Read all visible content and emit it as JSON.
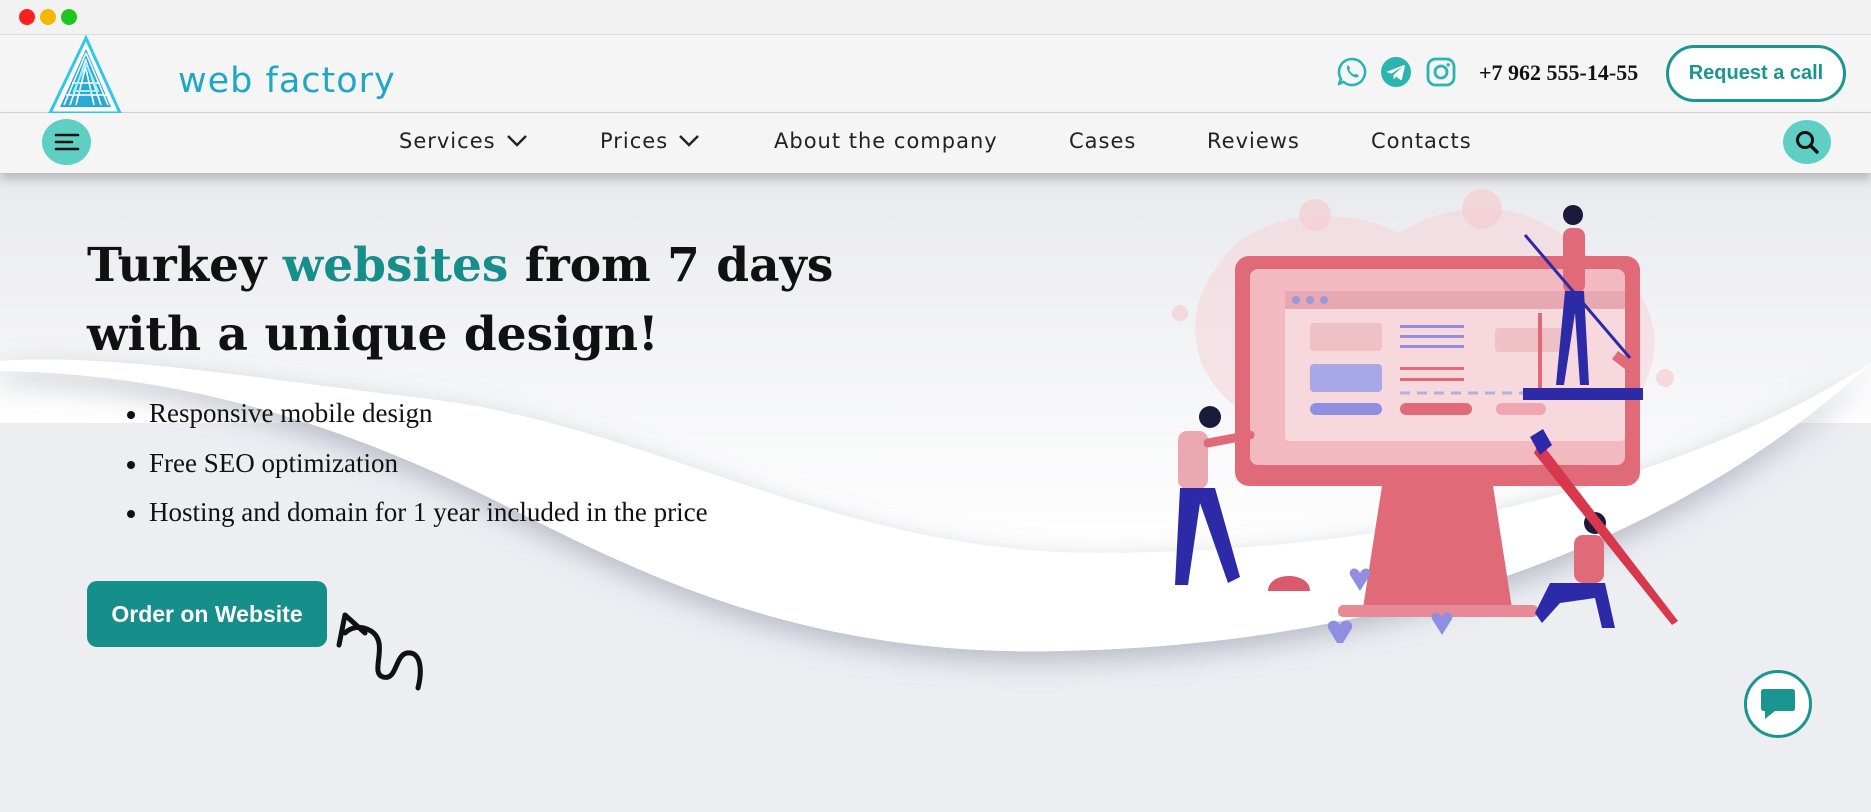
{
  "header": {
    "logo_text": "web factory",
    "phone": "+7 962 555-14-55",
    "request_call_label": "Request a call",
    "social_icons": [
      "whatsapp-icon",
      "telegram-icon",
      "instagram-icon"
    ]
  },
  "nav": {
    "items": [
      {
        "label": "Services",
        "dropdown": true
      },
      {
        "label": "Prices",
        "dropdown": true
      },
      {
        "label": "About the company",
        "dropdown": false
      },
      {
        "label": "Cases",
        "dropdown": false
      },
      {
        "label": "Reviews",
        "dropdown": false
      },
      {
        "label": "Contacts",
        "dropdown": false
      }
    ]
  },
  "hero": {
    "headline_part1": "Turkey ",
    "headline_accent": "websites",
    "headline_part2": " from 7 days with a unique design!",
    "bullets": [
      "Responsive mobile design",
      "Free SEO optimization",
      "Hosting and domain for 1 year included in the price"
    ],
    "order_button_label": "Order on Website"
  },
  "colors": {
    "accent": "#168f8a",
    "accent_light": "#5fcfc4",
    "illustration_primary": "#e06a78",
    "illustration_secondary": "#2d2aa8"
  }
}
